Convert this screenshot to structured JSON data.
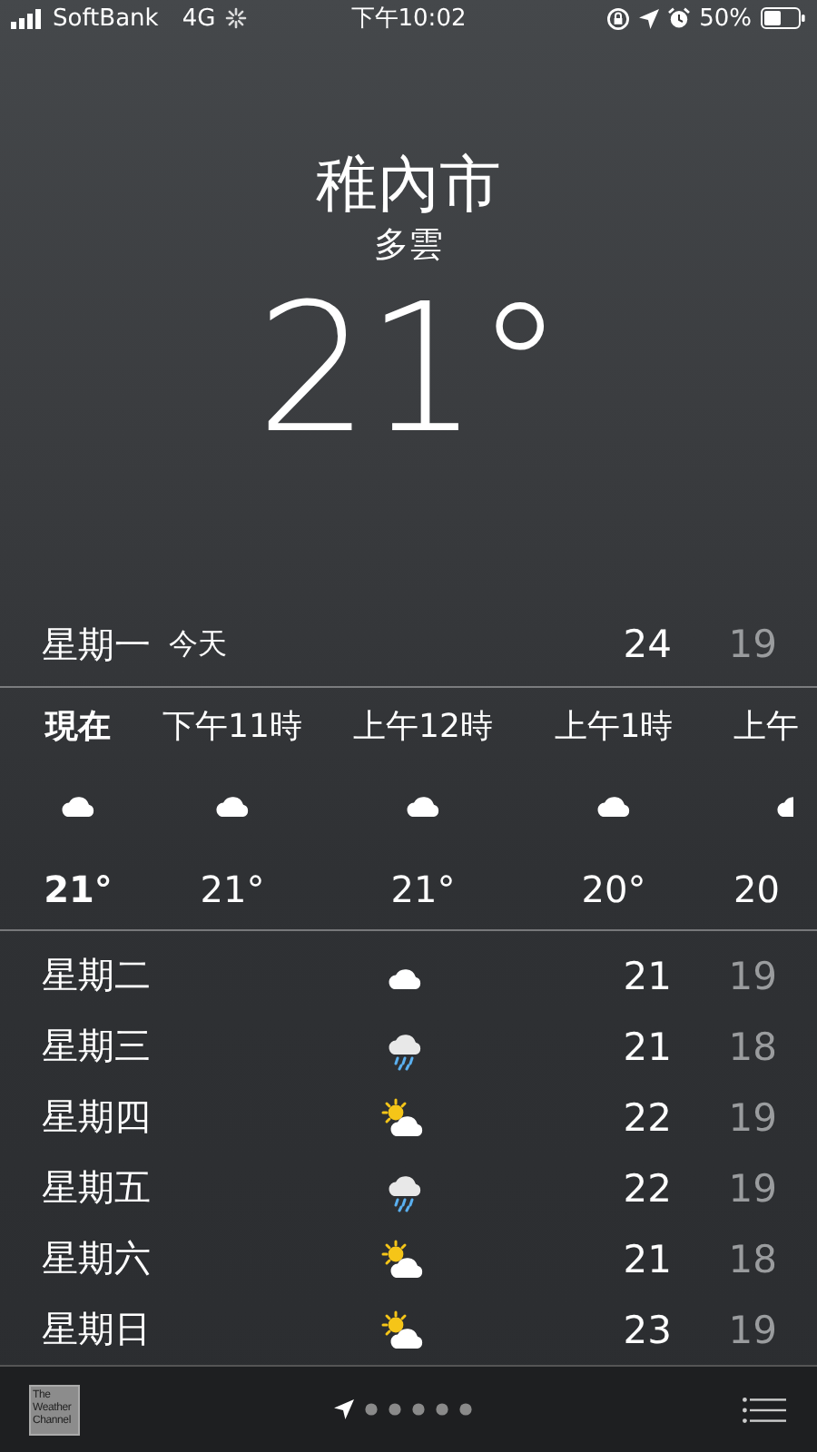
{
  "status_bar": {
    "carrier": "SoftBank",
    "network": "4G",
    "time": "下午10:02",
    "battery": "50%"
  },
  "location": {
    "city": "稚內市",
    "condition": "多雲",
    "temperature": "21°"
  },
  "today": {
    "day": "星期一",
    "label": "今天",
    "high": "24",
    "low": "19"
  },
  "hourly": [
    {
      "time": "現在",
      "kind": "cloud",
      "temp": "21°",
      "current": true
    },
    {
      "time": "下午11時",
      "kind": "cloud",
      "temp": "21°",
      "current": false
    },
    {
      "time": "上午12時",
      "kind": "cloud",
      "temp": "21°",
      "current": false
    },
    {
      "time": "上午1時",
      "kind": "cloud",
      "temp": "20°",
      "current": false
    },
    {
      "time": "上午",
      "kind": "cloud",
      "temp": "20",
      "current": false
    }
  ],
  "daily": [
    {
      "day": "星期二",
      "kind": "cloud",
      "high": "21",
      "low": "19"
    },
    {
      "day": "星期三",
      "kind": "rain",
      "high": "21",
      "low": "18"
    },
    {
      "day": "星期四",
      "kind": "sun-cloud",
      "high": "22",
      "low": "19"
    },
    {
      "day": "星期五",
      "kind": "rain",
      "high": "22",
      "low": "19"
    },
    {
      "day": "星期六",
      "kind": "sun-cloud",
      "high": "21",
      "low": "18"
    },
    {
      "day": "星期日",
      "kind": "sun-cloud",
      "high": "23",
      "low": "19"
    }
  ],
  "bottom_bar": {
    "logo": "The Weather Channel",
    "pages": [
      {
        "kind": "location",
        "selected": true
      },
      {
        "kind": "dot",
        "selected": false
      },
      {
        "kind": "dot",
        "selected": false
      },
      {
        "kind": "dot",
        "selected": false
      },
      {
        "kind": "dot",
        "selected": false
      },
      {
        "kind": "dot",
        "selected": false
      }
    ]
  }
}
